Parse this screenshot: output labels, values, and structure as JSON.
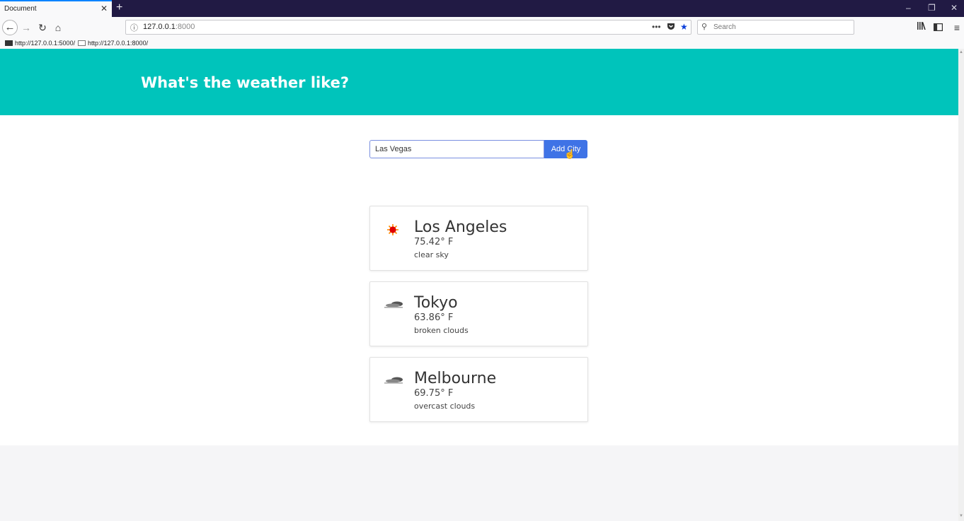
{
  "browser": {
    "tab_title": "Document",
    "tab_close": "✕",
    "new_tab": "+",
    "window_controls": {
      "minimize": "–",
      "restore": "❐",
      "close": "✕"
    },
    "url_host": "127.0.0.1",
    "url_port": ":8000",
    "search_placeholder": "Search",
    "bookmarks": [
      "http://127.0.0.1:5000/",
      "http://127.0.0.1:8000/"
    ],
    "icons": [
      "back-icon",
      "forward-icon",
      "reload-icon",
      "home-icon",
      "info-icon",
      "more-icon",
      "pocket-icon",
      "star-icon",
      "library-icon",
      "sidebar-icon",
      "menu-icon"
    ]
  },
  "hero": {
    "title": "What's the weather like?"
  },
  "form": {
    "input_value": "Las Vegas",
    "button_label": "Add City"
  },
  "cities": [
    {
      "name": "Los Angeles",
      "temp": "75.42° F",
      "description": "clear sky",
      "icon": "sun-icon"
    },
    {
      "name": "Tokyo",
      "temp": "63.86° F",
      "description": "broken clouds",
      "icon": "cloud-icon"
    },
    {
      "name": "Melbourne",
      "temp": "69.75° F",
      "description": "overcast clouds",
      "icon": "cloud-icon"
    }
  ],
  "colors": {
    "hero": "#00c4bb",
    "button": "#3f73e6",
    "tabbar": "#211a44"
  }
}
